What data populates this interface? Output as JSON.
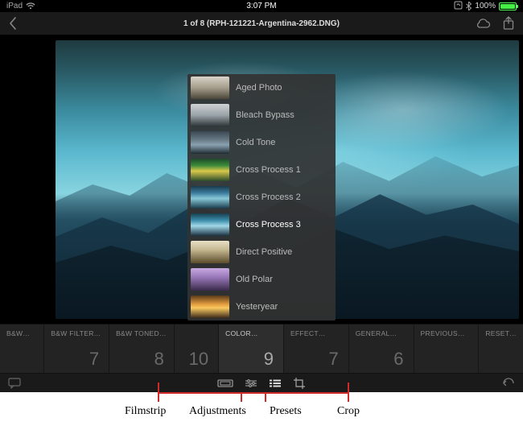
{
  "statusbar": {
    "device": "iPad",
    "time": "3:07 PM",
    "battery_pct": "100%"
  },
  "header": {
    "title": "1 of 8 (RPH-121221-Argentina-2962.DNG)"
  },
  "presets": {
    "items": [
      {
        "label": "Aged Photo",
        "thumb_class": "th-aged",
        "selected": false
      },
      {
        "label": "Bleach Bypass",
        "thumb_class": "th-bleach",
        "selected": false
      },
      {
        "label": "Cold Tone",
        "thumb_class": "th-cold",
        "selected": false
      },
      {
        "label": "Cross Process 1",
        "thumb_class": "th-cp1",
        "selected": false
      },
      {
        "label": "Cross Process 2",
        "thumb_class": "th-cp2",
        "selected": false
      },
      {
        "label": "Cross Process 3",
        "thumb_class": "th-cp3",
        "selected": true
      },
      {
        "label": "Direct Positive",
        "thumb_class": "th-direct",
        "selected": false
      },
      {
        "label": "Old Polar",
        "thumb_class": "th-oldpolar",
        "selected": false
      },
      {
        "label": "Yesteryear",
        "thumb_class": "th-yester",
        "selected": false
      }
    ]
  },
  "categories": [
    {
      "name": "B&W…",
      "count": "",
      "selected": false,
      "narrow": true,
      "no_count": true
    },
    {
      "name": "B&W FILTER…",
      "count": "7",
      "selected": false
    },
    {
      "name": "B&W TONED…",
      "count": "8",
      "selected": false
    },
    {
      "name": "",
      "count": "10",
      "selected": false,
      "narrow": true
    },
    {
      "name": "COLOR…",
      "count": "9",
      "selected": true
    },
    {
      "name": "EFFECT…",
      "count": "7",
      "selected": false
    },
    {
      "name": "GENERAL…",
      "count": "6",
      "selected": false
    },
    {
      "name": "PREVIOUS…",
      "count": "",
      "selected": false,
      "no_count": true
    },
    {
      "name": "RESET…",
      "count": "",
      "selected": false,
      "narrow": true,
      "no_count": true
    }
  ],
  "annotation": {
    "labels": {
      "filmstrip": "Filmstrip",
      "adjustments": "Adjustments",
      "presets": "Presets",
      "crop": "Crop"
    }
  }
}
